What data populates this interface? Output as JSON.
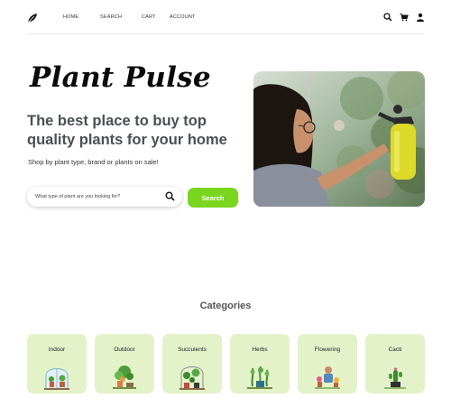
{
  "nav": {
    "logo_icon": "leaf-icon",
    "links": [
      "HOME",
      "SEARCH",
      "CART",
      "ACCOUNT"
    ],
    "icons": [
      "search-icon",
      "cart-icon",
      "user-icon"
    ]
  },
  "hero": {
    "brand": "Plant Pulse",
    "headline": "The best place to buy top quality plants for your home",
    "subline": "Shop by plant type, brand or plants on sale!",
    "search_placeholder": "What type of plant are you looking for?",
    "search_button": "Search",
    "photo": "woman-spraying-plants-photo"
  },
  "categories": {
    "title": "Categories",
    "items": [
      {
        "label": "Indoor",
        "icon": "indoor-plants-illustration"
      },
      {
        "label": "Outdoor",
        "icon": "outdoor-gardening-illustration"
      },
      {
        "label": "Succulents",
        "icon": "succulents-illustration"
      },
      {
        "label": "Herbs",
        "icon": "herbs-illustration"
      },
      {
        "label": "Flowering",
        "icon": "flowering-plants-illustration"
      },
      {
        "label": "Cacti",
        "icon": "cacti-illustration"
      }
    ]
  },
  "colors": {
    "accent": "#7ad51e",
    "card_bg": "#e3f2c9",
    "headline": "#4a4f55"
  }
}
